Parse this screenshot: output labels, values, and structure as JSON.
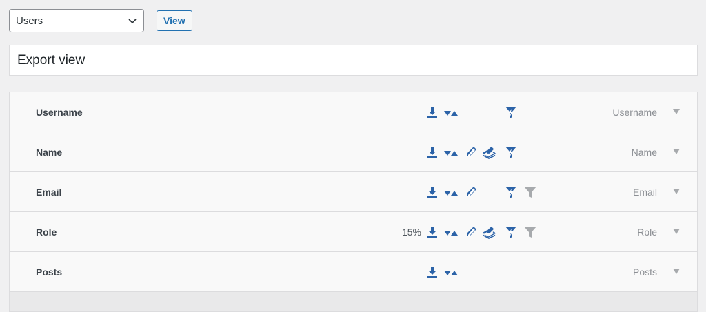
{
  "top": {
    "select_value": "Users",
    "view_button": "View"
  },
  "title_input": {
    "value": "Export view"
  },
  "rows": [
    {
      "label": "Username",
      "right_label": "Username",
      "percent": "",
      "icons": [
        "download-icon",
        "sort-icon",
        "filter-smart-icon"
      ]
    },
    {
      "label": "Name",
      "right_label": "Name",
      "percent": "",
      "icons": [
        "download-icon",
        "sort-icon",
        "edit-icon",
        "bulk-edit-icon",
        "filter-smart-icon"
      ]
    },
    {
      "label": "Email",
      "right_label": "Email",
      "percent": "",
      "icons": [
        "download-icon",
        "sort-icon",
        "edit-icon",
        "filter-smart-icon",
        "filter-icon"
      ]
    },
    {
      "label": "Role",
      "right_label": "Role",
      "percent": "15%",
      "icons": [
        "download-icon",
        "sort-icon",
        "edit-icon",
        "bulk-edit-icon",
        "filter-smart-icon",
        "filter-icon"
      ]
    },
    {
      "label": "Posts",
      "right_label": "Posts",
      "percent": "",
      "icons": [
        "download-icon",
        "sort-icon"
      ]
    }
  ],
  "colors": {
    "accent": "#2271b1",
    "icon_active": "#2c63a8",
    "icon_inactive": "#a7aaad"
  }
}
